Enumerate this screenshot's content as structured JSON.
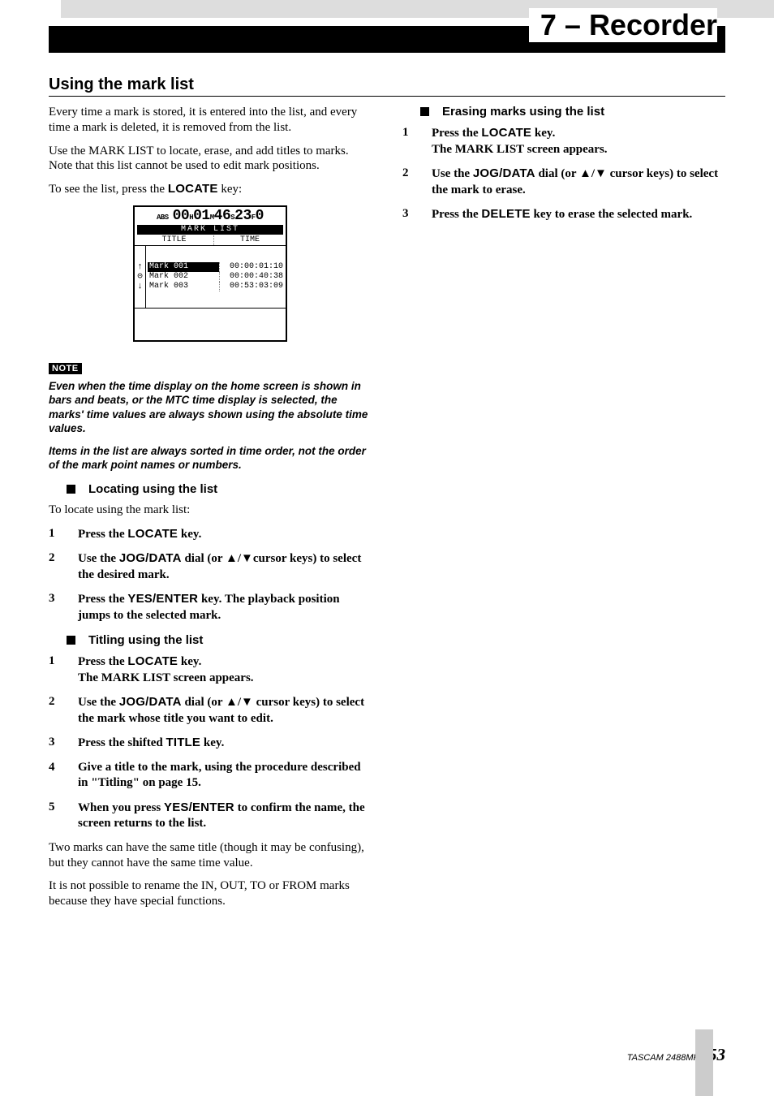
{
  "header": {
    "chapter": "7 – Recorder"
  },
  "section": {
    "title": "Using the mark list"
  },
  "col1": {
    "p1": "Every time a mark is stored, it is entered into the list, and every time a mark is deleted, it is removed from the list.",
    "p2": "Use the MARK LIST to locate, erase, and add titles to marks. Note that this list cannot be used to edit mark positions.",
    "p3_a": "To see the list, press the ",
    "p3_key": "LOCATE",
    "p3_b": " key:",
    "lcd": {
      "abs": "ABS",
      "time_big": "00 01 46 23 0",
      "time_units": "H M S F",
      "title": "MARK LIST",
      "hdr_title": "TITLE",
      "hdr_time": "TIME",
      "rows": [
        {
          "title": "Mark 001",
          "time": "00:00:01:10",
          "selected": true
        },
        {
          "title": "Mark 002",
          "time": "00:00:40:38",
          "selected": false
        },
        {
          "title": "Mark 003",
          "time": "00:53:03:09",
          "selected": false
        }
      ]
    },
    "note_label": "NOTE",
    "note1": "Even when the time display on the home screen is shown in bars and beats, or the MTC time display is selected, the marks' time values are always shown using the absolute time values.",
    "note2": "Items in the list are always sorted in time order, not the order of the mark point names or numbers.",
    "sub_locating": "Locating using the list",
    "locating_intro": "To locate using the mark list:",
    "loc1_a": "Press the ",
    "loc1_key": "LOCATE",
    "loc1_b": " key.",
    "loc2_a": "Use the ",
    "loc2_key": "JOG/DATA",
    "loc2_b": " dial (or ▲/▼cursor keys) to select the desired mark.",
    "loc3_a": "Press the ",
    "loc3_key": "YES/ENTER",
    "loc3_b": " key. The playback position jumps to the selected mark.",
    "sub_titling": "Titling using the list",
    "tit1_a": "Press the ",
    "tit1_key": "LOCATE",
    "tit1_b": " key.",
    "tit1_c": "The MARK LIST screen appears.",
    "tit2_a": "Use the ",
    "tit2_key": "JOG/DATA",
    "tit2_b": " dial (or ▲/▼ cursor keys) to select the mark whose title you want to edit.",
    "tit3_a": "Press the shifted ",
    "tit3_key": "TITLE",
    "tit3_b": " key.",
    "tit4": "Give a title to the mark, using the procedure described in \"Titling\" on page 15.",
    "tit5_a": "When you press ",
    "tit5_key": "YES/ENTER",
    "tit5_b": " to confirm the name, the screen returns to the list.",
    "after1": "Two marks can have the same title (though it may be confusing), but they cannot have the same time value.",
    "after2": "It is not possible to rename the IN, OUT, TO or FROM marks because they have special functions."
  },
  "col2": {
    "sub_erasing": "Erasing marks using the list",
    "er1_a": "Press the ",
    "er1_key": "LOCATE",
    "er1_b": " key.",
    "er1_c": "The MARK LIST screen appears.",
    "er2_a": "Use the ",
    "er2_key": "JOG/DATA",
    "er2_b": " dial (or ▲/▼ cursor keys) to select the mark to erase.",
    "er3_a": "Press the ",
    "er3_key": "DELETE",
    "er3_b": " key to erase the selected mark."
  },
  "footer": {
    "product": "TASCAM  2488MKII",
    "page": "53"
  }
}
